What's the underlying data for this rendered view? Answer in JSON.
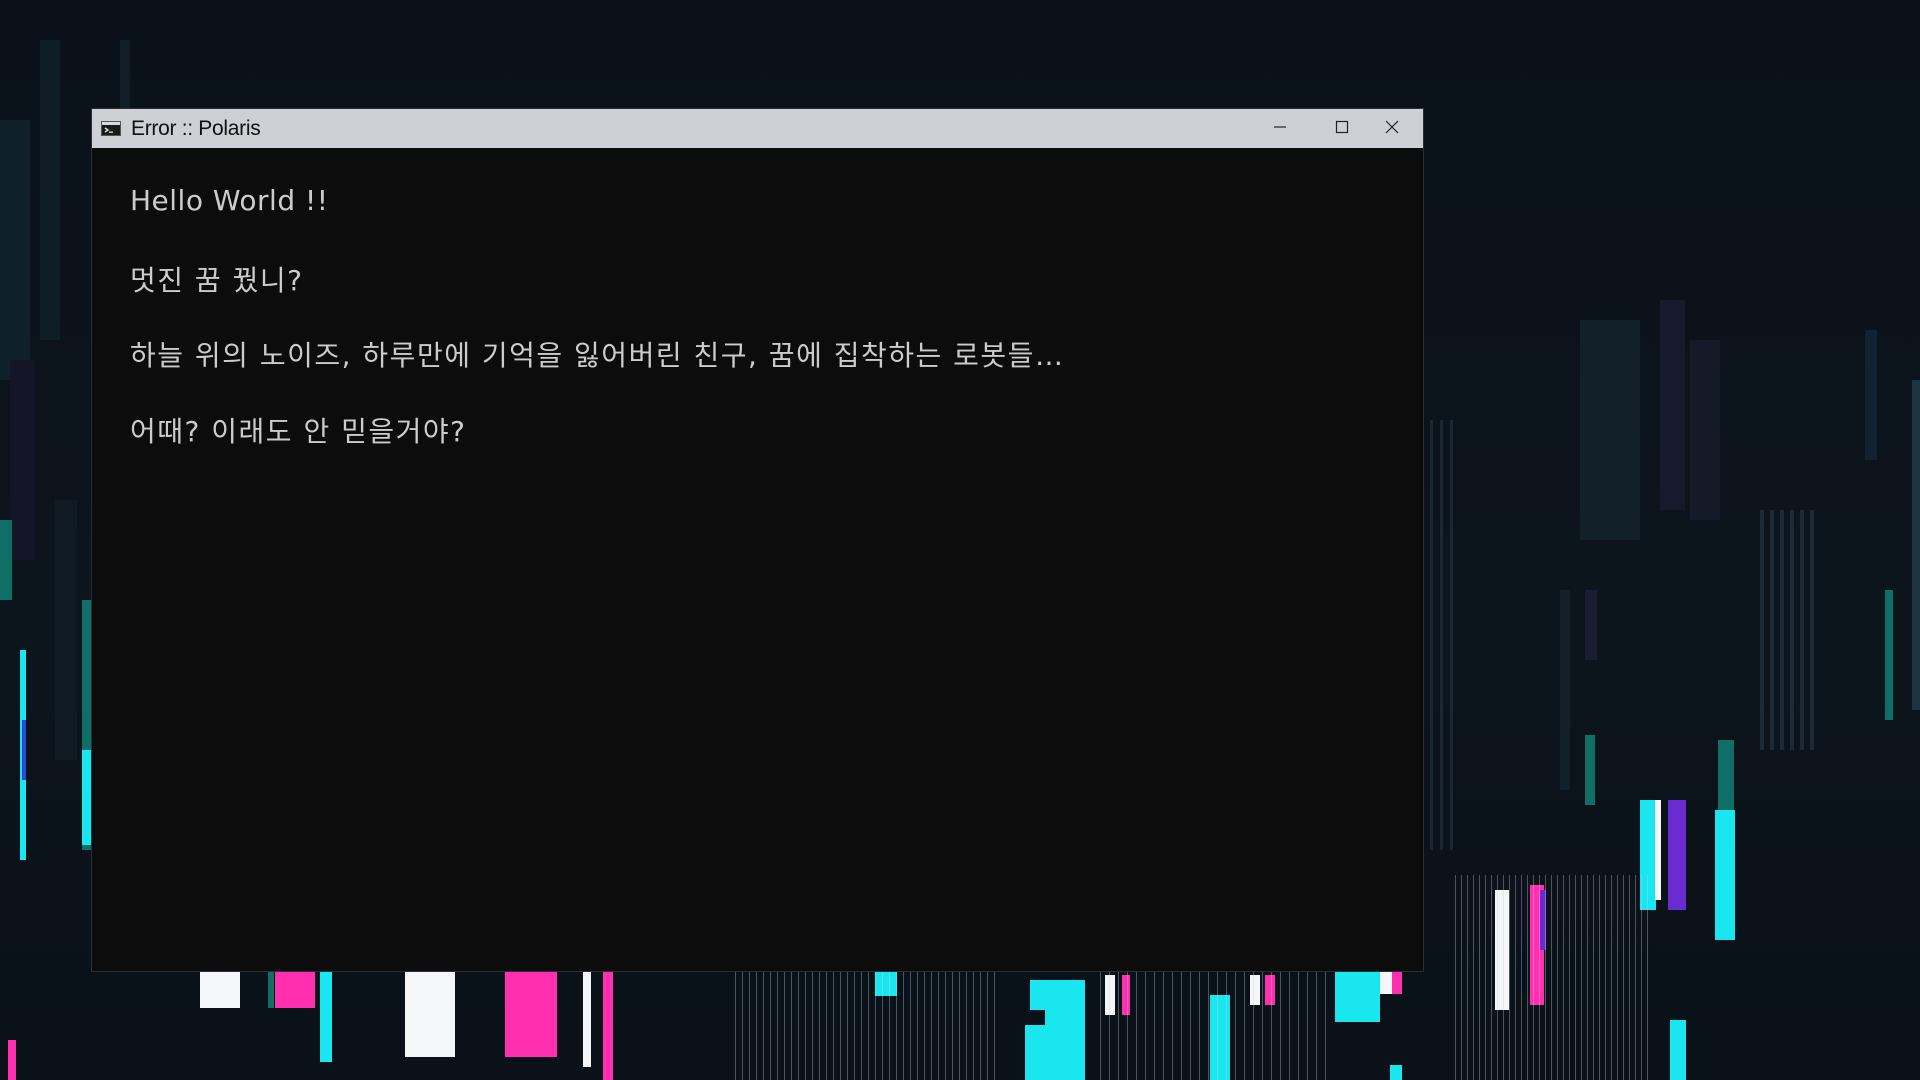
{
  "window": {
    "title": "Error :: Polaris",
    "controls": {
      "minimize": "minimize",
      "maximize": "maximize",
      "close": "close"
    }
  },
  "console": {
    "lines": [
      "Hello World !!",
      "멋진 꿈 꿨니?",
      "하늘 위의 노이즈, 하루만에 기억을 잃어버린 친구, 꿈에 집착하는 로봇들…",
      "어때? 이래도 안 믿을거야?"
    ]
  },
  "colors": {
    "desktop_bg": "#0b121a",
    "console_bg": "#0c0c0c",
    "console_text": "#cccccc",
    "titlebar_bg": "#cdd1d5",
    "glitch_cyan": "#19e6ef",
    "glitch_magenta": "#ff2fb0",
    "glitch_white": "#f4f6f8",
    "glitch_purple": "#6a2bd1",
    "glitch_teal": "#0f6f66"
  },
  "icons": {
    "app": "console-icon",
    "minimize": "minimize-icon",
    "maximize": "maximize-icon",
    "close": "close-icon"
  }
}
